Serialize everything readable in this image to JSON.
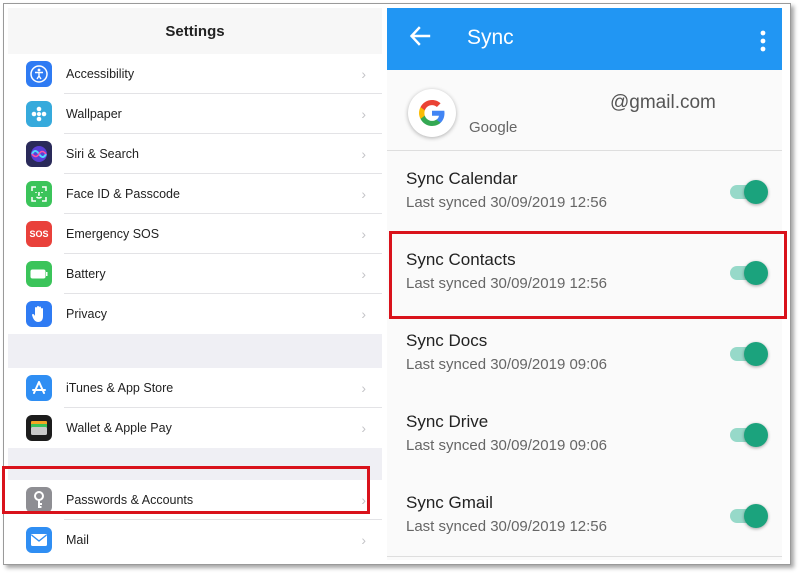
{
  "settings": {
    "title": "Settings",
    "group1": [
      {
        "label": "Accessibility",
        "icon": "accessibility-icon",
        "color": "#2f7bf3"
      },
      {
        "label": "Wallpaper",
        "icon": "wallpaper-icon",
        "color": "#36aadc"
      },
      {
        "label": "Siri & Search",
        "icon": "siri-icon",
        "color": "#2a2a5a"
      },
      {
        "label": "Face ID & Passcode",
        "icon": "face-id-icon",
        "color": "#3bc45a"
      },
      {
        "label": "Emergency SOS",
        "icon": "sos-icon",
        "color": "#e9413b",
        "glyph": "SOS"
      },
      {
        "label": "Battery",
        "icon": "battery-icon",
        "color": "#3bc45a"
      },
      {
        "label": "Privacy",
        "icon": "privacy-hand-icon",
        "color": "#2f7bf3"
      }
    ],
    "group2": [
      {
        "label": "iTunes & App Store",
        "icon": "app-store-icon",
        "color": "#2f8ef3"
      },
      {
        "label": "Wallet & Apple Pay",
        "icon": "wallet-icon",
        "color": "#1c1c1c"
      }
    ],
    "group3": [
      {
        "label": "Passwords & Accounts",
        "icon": "key-icon",
        "color": "#8e8e93"
      },
      {
        "label": "Mail",
        "icon": "mail-icon",
        "color": "#2f8ef3"
      }
    ],
    "chevron": "›"
  },
  "sync": {
    "title": "Sync",
    "account_email": "@gmail.com",
    "account_type": "Google",
    "bar_color": "#2196f3",
    "toggle_color": "#1ba37d",
    "items": [
      {
        "name": "Sync Calendar",
        "last_synced": "Last synced 30/09/2019 12:56",
        "enabled": true
      },
      {
        "name": "Sync Contacts",
        "last_synced": "Last synced 30/09/2019 12:56",
        "enabled": true
      },
      {
        "name": "Sync Docs",
        "last_synced": "Last synced 30/09/2019 09:06",
        "enabled": true
      },
      {
        "name": "Sync Drive",
        "last_synced": "Last synced 30/09/2019 09:06",
        "enabled": true
      },
      {
        "name": "Sync Gmail",
        "last_synced": "Last synced 30/09/2019 12:56",
        "enabled": true
      }
    ]
  },
  "highlight_color": "#d9121b"
}
